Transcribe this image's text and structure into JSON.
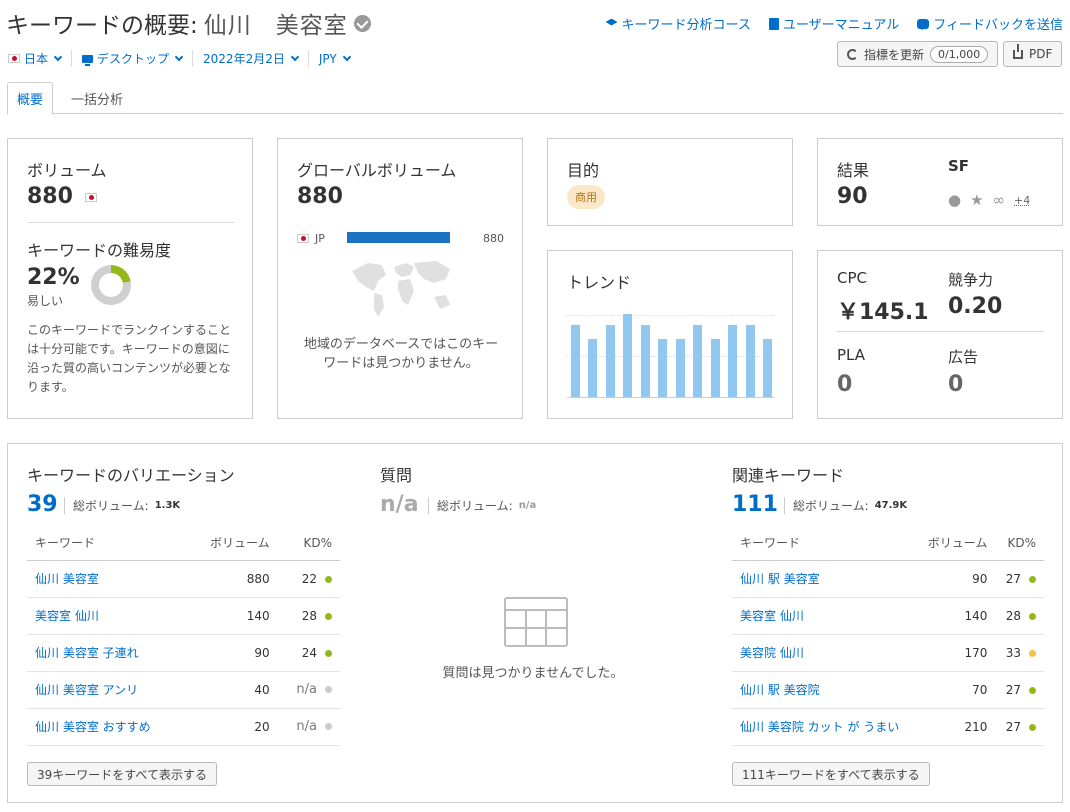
{
  "header": {
    "title_prefix": "キーワードの概要:",
    "keyword": "仙川　美容室",
    "links": {
      "course": "キーワード分析コース",
      "manual": "ユーザーマニュアル",
      "feedback": "フィードバックを送信"
    },
    "update_btn": "指標を更新",
    "update_counter": "0/1,000",
    "pdf_btn": "PDF"
  },
  "filters": {
    "country": "日本",
    "device": "デスクトップ",
    "date": "2022年2月2日",
    "currency": "JPY"
  },
  "tabs": {
    "overview": "概要",
    "bulk": "一括分析"
  },
  "volume_card": {
    "title": "ボリューム",
    "value": "880",
    "kd_title": "キーワードの難易度",
    "kd_value": "22%",
    "kd_label": "易しい",
    "kd_percent": 22,
    "kd_desc": "このキーワードでランクインすることは十分可能です。キーワードの意図に沿った質の高いコンテンツが必要となります。"
  },
  "global_card": {
    "title": "グローバルボリューム",
    "value": "880",
    "country_code": "JP",
    "country_value": "880",
    "empty_msg": "地域のデータベースではこのキーワードは見つかりません。"
  },
  "intent_card": {
    "title": "目的",
    "badge": "商用"
  },
  "trend_card": {
    "title": "トレンド",
    "values": [
      0.87,
      0.7,
      0.87,
      1.0,
      0.87,
      0.7,
      0.7,
      0.87,
      0.7,
      0.87,
      0.87,
      0.7
    ]
  },
  "results_card": {
    "results_label": "結果",
    "results_value": "90",
    "sf_label": "SF",
    "sf_more": "+4"
  },
  "cpc_card": {
    "cpc_label": "CPC",
    "cpc_value": "￥145.1",
    "comp_label": "競争力",
    "comp_value": "0.20",
    "pla_label": "PLA",
    "pla_value": "0",
    "ads_label": "広告",
    "ads_value": "0"
  },
  "variations": {
    "title": "キーワードのバリエーション",
    "count": "39",
    "total_label": "総ボリューム:",
    "total_value": "1.3K",
    "col_keyword": "キーワード",
    "col_volume": "ボリューム",
    "col_kd": "KD%",
    "rows": [
      {
        "keyword": "仙川 美容室",
        "volume": "880",
        "kd": "22",
        "kd_color": "#94b81a"
      },
      {
        "keyword": "美容室 仙川",
        "volume": "140",
        "kd": "28",
        "kd_color": "#94b81a"
      },
      {
        "keyword": "仙川 美容室 子連れ",
        "volume": "90",
        "kd": "24",
        "kd_color": "#94b81a"
      },
      {
        "keyword": "仙川 美容室 アンリ",
        "volume": "40",
        "kd": "n/a",
        "kd_color": "#cccccc"
      },
      {
        "keyword": "仙川 美容室 おすすめ",
        "volume": "20",
        "kd": "n/a",
        "kd_color": "#cccccc"
      }
    ],
    "show_all": "39キーワードをすべて表示する"
  },
  "questions": {
    "title": "質問",
    "count": "n/a",
    "total_label": "総ボリューム:",
    "total_value": "n/a",
    "empty_msg": "質問は見つかりませんでした。"
  },
  "related": {
    "title": "関連キーワード",
    "count": "111",
    "total_label": "総ボリューム:",
    "total_value": "47.9K",
    "col_keyword": "キーワード",
    "col_volume": "ボリューム",
    "col_kd": "KD%",
    "rows": [
      {
        "keyword": "仙川 駅 美容室",
        "volume": "90",
        "kd": "27",
        "kd_color": "#94b81a"
      },
      {
        "keyword": "美容室 仙川",
        "volume": "140",
        "kd": "28",
        "kd_color": "#94b81a"
      },
      {
        "keyword": "美容院 仙川",
        "volume": "170",
        "kd": "33",
        "kd_color": "#f5c342"
      },
      {
        "keyword": "仙川 駅 美容院",
        "volume": "70",
        "kd": "27",
        "kd_color": "#94b81a"
      },
      {
        "keyword": "仙川 美容院 カット が うまい",
        "volume": "210",
        "kd": "27",
        "kd_color": "#94b81a"
      }
    ],
    "show_all": "111キーワードをすべて表示する"
  }
}
